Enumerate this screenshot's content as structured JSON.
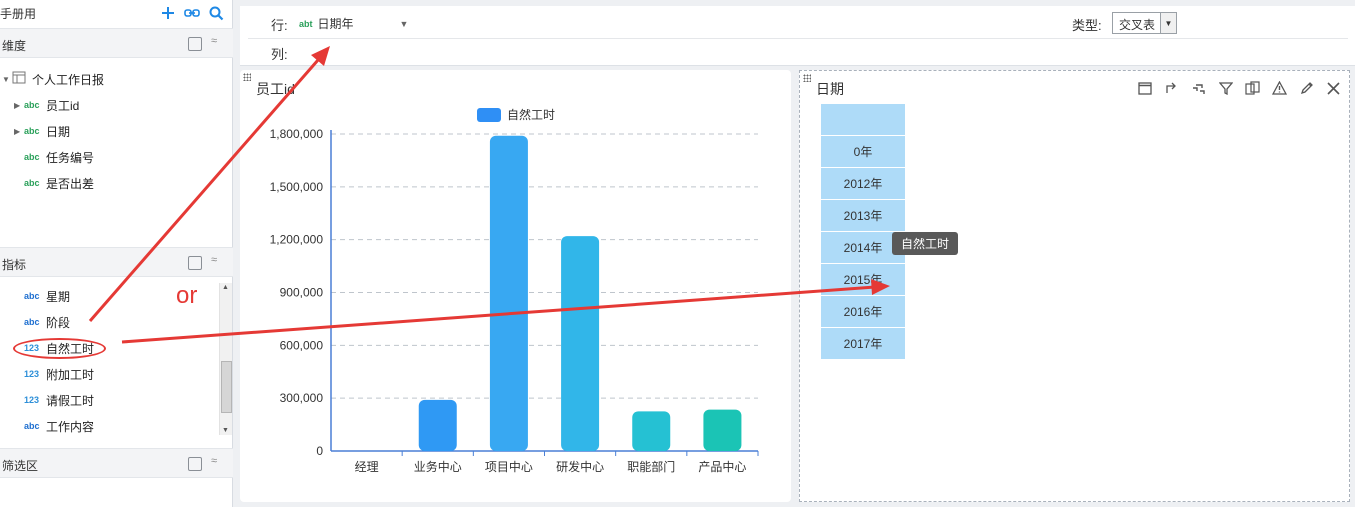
{
  "left": {
    "header_title": "手册用",
    "header_icons": [
      "plus-icon",
      "link-icon",
      "search-icon"
    ],
    "dimensions": {
      "title": "维度",
      "root": "个人工作日报",
      "items": [
        {
          "tag": "abc",
          "label": "员工id"
        },
        {
          "tag": "abc",
          "label": "日期"
        },
        {
          "tag": "abc",
          "label": "任务编号"
        },
        {
          "tag": "abc",
          "label": "是否出差"
        }
      ]
    },
    "metrics": {
      "title": "指标",
      "items": [
        {
          "tag": "abc",
          "label": "星期"
        },
        {
          "tag": "abc",
          "label": "阶段"
        },
        {
          "tag": "123",
          "label": "自然工时"
        },
        {
          "tag": "123",
          "label": "附加工时"
        },
        {
          "tag": "123",
          "label": "请假工时"
        },
        {
          "tag": "abc",
          "label": "工作内容"
        }
      ]
    },
    "filter": {
      "title": "筛选区"
    },
    "or_label": "or"
  },
  "topbar": {
    "row_label": "行:",
    "row_field_tag": "abt",
    "row_field": "日期年",
    "col_label": "列:",
    "type_label": "类型:",
    "type_value": "交叉表"
  },
  "chart_panel": {
    "title": "员工id"
  },
  "chart_data": {
    "type": "bar",
    "categories": [
      "经理",
      "业务中心",
      "项目中心",
      "研发中心",
      "职能部门",
      "产品中心"
    ],
    "series": [
      {
        "name": "自然工时",
        "values": [
          0,
          290000,
          1790000,
          1220000,
          225000,
          235000
        ]
      }
    ],
    "ylim": [
      0,
      1800000
    ],
    "yticks": [
      "0",
      "300,000",
      "600,000",
      "900,000",
      "1,200,000",
      "1,500,000",
      "1,800,000"
    ],
    "legend": "top-center",
    "grid": true,
    "colors": [
      "#2f8ff5",
      "#2f99f4",
      "#38a8f2",
      "#31b6e9",
      "#25c1d3",
      "#1bc4b5"
    ]
  },
  "right_panel": {
    "title": "日期",
    "tool_icons": [
      "maximize-icon",
      "share-icon",
      "drill-icon",
      "filter-icon",
      "export-icon",
      "warning-icon",
      "edit-icon",
      "close-icon"
    ],
    "rows": [
      "",
      "0年",
      "2012年",
      "2013年",
      "2014年",
      "2015年",
      "2016年",
      "2017年"
    ],
    "tooltip": "自然工时"
  }
}
